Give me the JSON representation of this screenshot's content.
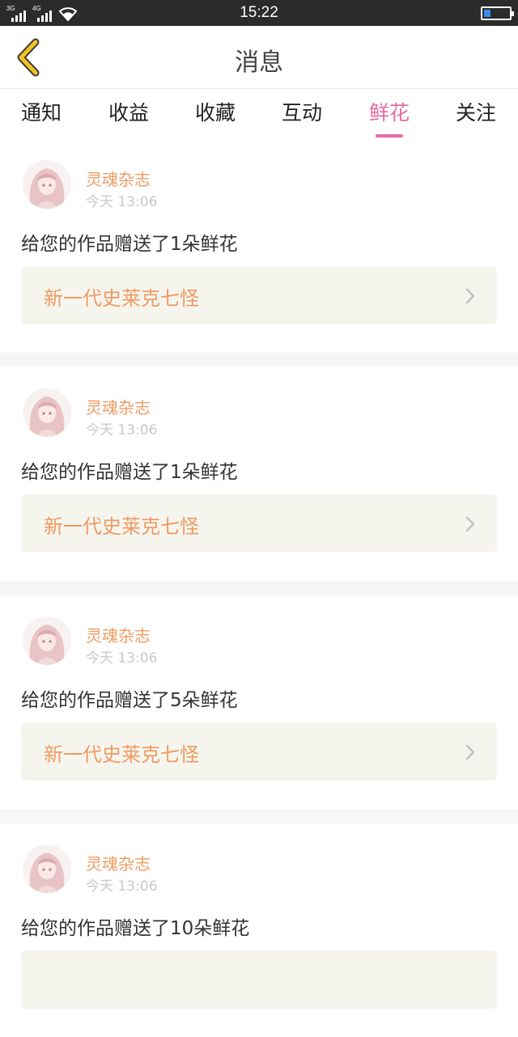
{
  "status_bar": {
    "time": "15:22",
    "sim1_label": "3G",
    "sim2_label": "4G",
    "battery_color": "#3a8ee6"
  },
  "header": {
    "title": "消息",
    "back_icon": "chevron-left-icon",
    "back_icon_color": "#f3c321"
  },
  "tabs": [
    {
      "label": "通知",
      "active": false
    },
    {
      "label": "收益",
      "active": false
    },
    {
      "label": "收藏",
      "active": false
    },
    {
      "label": "互动",
      "active": false
    },
    {
      "label": "鲜花",
      "active": true
    },
    {
      "label": "关注",
      "active": false
    }
  ],
  "accent_color": "#e66aa6",
  "messages": [
    {
      "sender": "灵魂杂志",
      "time": "今天 13:06",
      "text": "给您的作品赠送了1朵鲜花",
      "work": "新一代史莱克七怪"
    },
    {
      "sender": "灵魂杂志",
      "time": "今天 13:06",
      "text": "给您的作品赠送了1朵鲜花",
      "work": "新一代史莱克七怪"
    },
    {
      "sender": "灵魂杂志",
      "time": "今天 13:06",
      "text": "给您的作品赠送了5朵鲜花",
      "work": "新一代史莱克七怪"
    },
    {
      "sender": "灵魂杂志",
      "time": "今天 13:06",
      "text": "给您的作品赠送了10朵鲜花",
      "work": ""
    }
  ]
}
